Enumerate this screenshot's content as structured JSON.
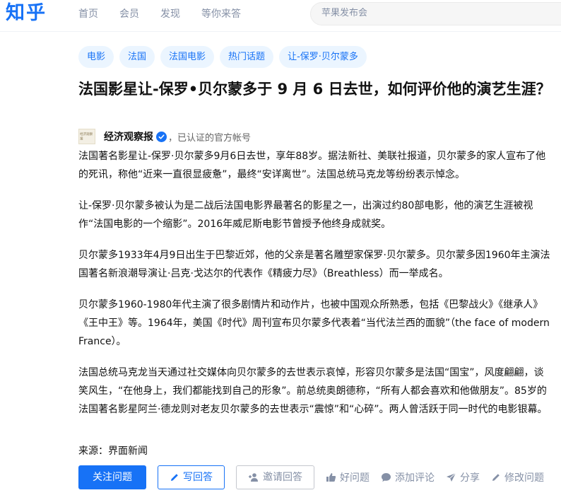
{
  "app": {
    "logo": "知乎"
  },
  "nav": {
    "items": [
      "首页",
      "会员",
      "发现",
      "等你来答"
    ]
  },
  "search": {
    "placeholder": "苹果发布会"
  },
  "tags": [
    "电影",
    "法国",
    "法国电影",
    "热门话题",
    "让-保罗·贝尔蒙多"
  ],
  "question": {
    "title": "法国影星让-保罗•贝尔蒙多于 9 月 6 日去世，如何评价他的演艺生涯？"
  },
  "author": {
    "avatar_text": "经济观察报",
    "name": "经济观察报",
    "desc": "，已认证的官方帐号"
  },
  "content": {
    "paragraphs": [
      "法国著名影星让-保罗·贝尔蒙多9月6日去世，享年88岁。据法新社、美联社报道，贝尔蒙多的家人宣布了他的死讯，称他“近来一直很显疲惫”，最终“安详离世”。法国总统马克龙等纷纷表示悼念。",
      "让-保罗·贝尔蒙多被认为是二战后法国电影界最著名的影星之一，出演过约80部电影，他的演艺生涯被视作“法国电影的一个缩影”。2016年威尼斯电影节曾授予他终身成就奖。",
      "贝尔蒙多1933年4月9日出生于巴黎近郊，他的父亲是著名雕塑家保罗·贝尔蒙多。贝尔蒙多因1960年主演法国著名新浪潮导演让·吕克·戈达尔的代表作《精疲力尽》（Breathless）而一举成名。",
      "贝尔蒙多1960-1980年代主演了很多剧情片和动作片，也被中国观众所熟悉，包括《巴黎战火》《继承人》《王中王》等。1964年，美国《时代》周刊宣布贝尔蒙多代表着“当代法兰西的面貌”（the face of modern France）。",
      "法国总统马克龙当天通过社交媒体向贝尔蒙多的去世表示哀悼，形容贝尔蒙多是法国“国宝”，风度翩翩，谈笑风生，“在他身上，我们都能找到自己的形象”。前总统奥朗德称，“所有人都会喜欢和他做朋友”。85岁的法国著名影星阿兰·德龙则对老友贝尔蒙多的去世表示“震惊”和“心碎”。两人曾活跃于同一时代的电影银幕。"
    ],
    "source": "来源：界面新闻"
  },
  "actions": {
    "follow": "关注问题",
    "write": "写回答",
    "invite": "邀请回答",
    "good": "好问题",
    "comment": "添加评论",
    "share": "分享",
    "edit": "修改问题"
  },
  "colors": {
    "brand": "#1772f6",
    "muted": "#8590a6"
  }
}
